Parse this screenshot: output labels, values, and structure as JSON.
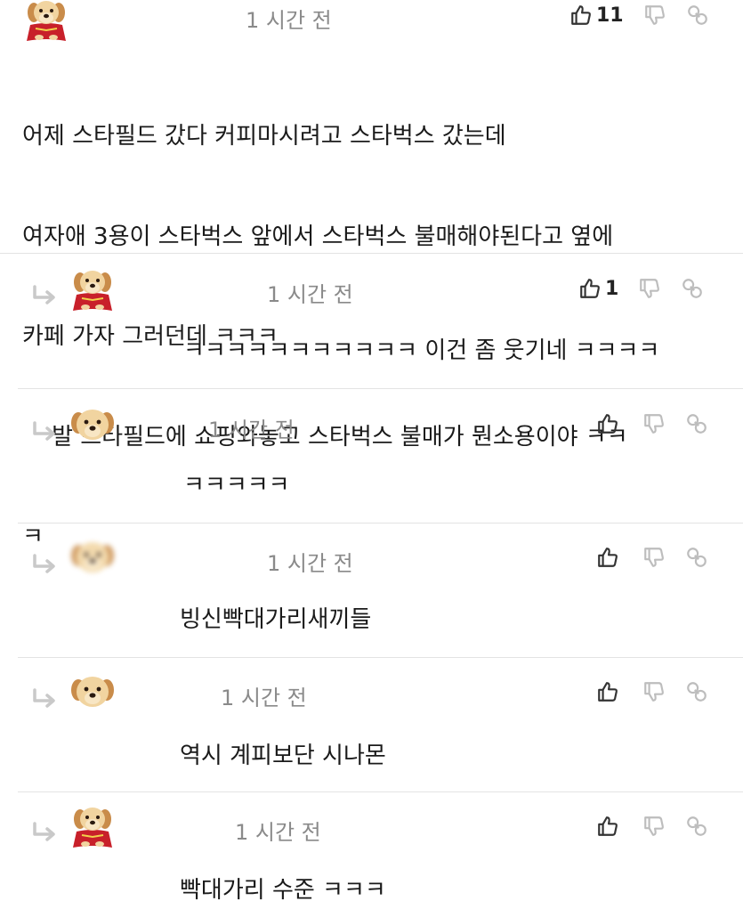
{
  "main_comment": {
    "time": "1 시간 전",
    "likes": "11",
    "lines": [
      "어제 스타필드 갔다 커피마시려고 스타벅스 갔는데",
      "여자애 3용이 스타벅스 앞에서 스타벅스 불매해야된다고 옆에",
      "카페 가자 그러던데 ㅋㅋㅋ",
      "    발 스타필드에 쇼핑와놓고 스타벅스 불매가 뭔소용이야 ㅋㅋ",
      "ㅋ"
    ]
  },
  "replies": [
    {
      "time": "1 시간 전",
      "likes": "1",
      "text": "ㅋㅋㅋㅋㅋㅋㅋㅋㅋㅋㅋ 이건 좀 웃기네 ㅋㅋㅋㅋ",
      "avatar": "puppy-cape"
    },
    {
      "time": "1 시간 전",
      "likes": "",
      "text": "ㅋㅋㅋㅋㅋ",
      "avatar": "puppy-face"
    },
    {
      "time": "1 시간 전",
      "likes": "",
      "text": "빙신빡대가리새끼들",
      "avatar": "puppy-face-blurred"
    },
    {
      "time": "1 시간 전",
      "likes": "",
      "text": "역시 계피보단 시나몬",
      "avatar": "puppy-face"
    },
    {
      "time": "1 시간 전",
      "likes": "",
      "text": "빡대가리 수준 ㅋㅋㅋ",
      "avatar": "puppy-cape"
    }
  ],
  "icons": {
    "like": "thumbs-up-icon",
    "dislike": "thumbs-down-icon",
    "share": "link-icon",
    "reply": "reply-arrow-icon"
  },
  "colors": {
    "timestamp": "#8a8a8a",
    "divider": "#e3e3e3",
    "text": "#1a1a1a",
    "icon_dark": "#333333",
    "icon_light": "#bdbdbd"
  }
}
